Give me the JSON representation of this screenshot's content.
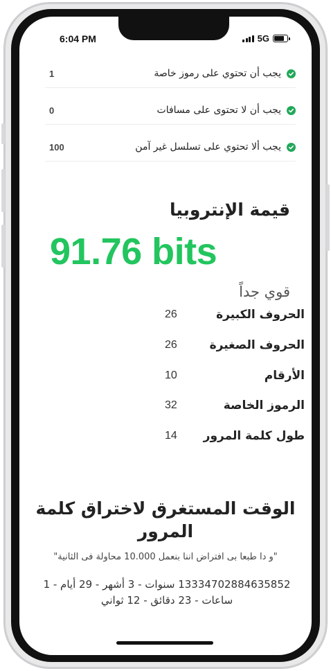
{
  "status_bar": {
    "time": "6:04 PM",
    "network": "5G"
  },
  "rules": [
    {
      "text": "يجب أن تحتوي على رموز خاصة",
      "count": "1"
    },
    {
      "text": "يجب أن لا تحتوى على مسافات",
      "count": "0"
    },
    {
      "text": "يجب ألا تحتوي على تسلسل غير آمن",
      "count": "100"
    }
  ],
  "entropy": {
    "heading": "قيمة الإنتروبيا",
    "value": "91.76 bits",
    "strength": "قوي جداً",
    "value_color": "#22c55e"
  },
  "stats": [
    {
      "label": "الحروف الكبيرة",
      "value": "26"
    },
    {
      "label": "الحروف الصغيرة",
      "value": "26"
    },
    {
      "label": "الأرقام",
      "value": "10"
    },
    {
      "label": "الرموز الخاصة",
      "value": "32"
    },
    {
      "label": "طول كلمة المرور",
      "value": "14"
    }
  ],
  "crack": {
    "heading": "الوقت المستغرق لاختراق كلمة المرور",
    "note": "\"و دا طبعا بى افتراض اننا بنعمل 10.000 محاولة فى الثانية\"",
    "time": "13334702884635852 سنوات - 3 أشهر - 29 أيام - 1 ساعات - 23 دقائق - 12 ثواني"
  },
  "icons": {
    "check": "check-circle-icon",
    "signal": "signal-bars-icon",
    "battery": "battery-icon"
  },
  "colors": {
    "check": "#22a85a",
    "accent": "#22c55e"
  }
}
